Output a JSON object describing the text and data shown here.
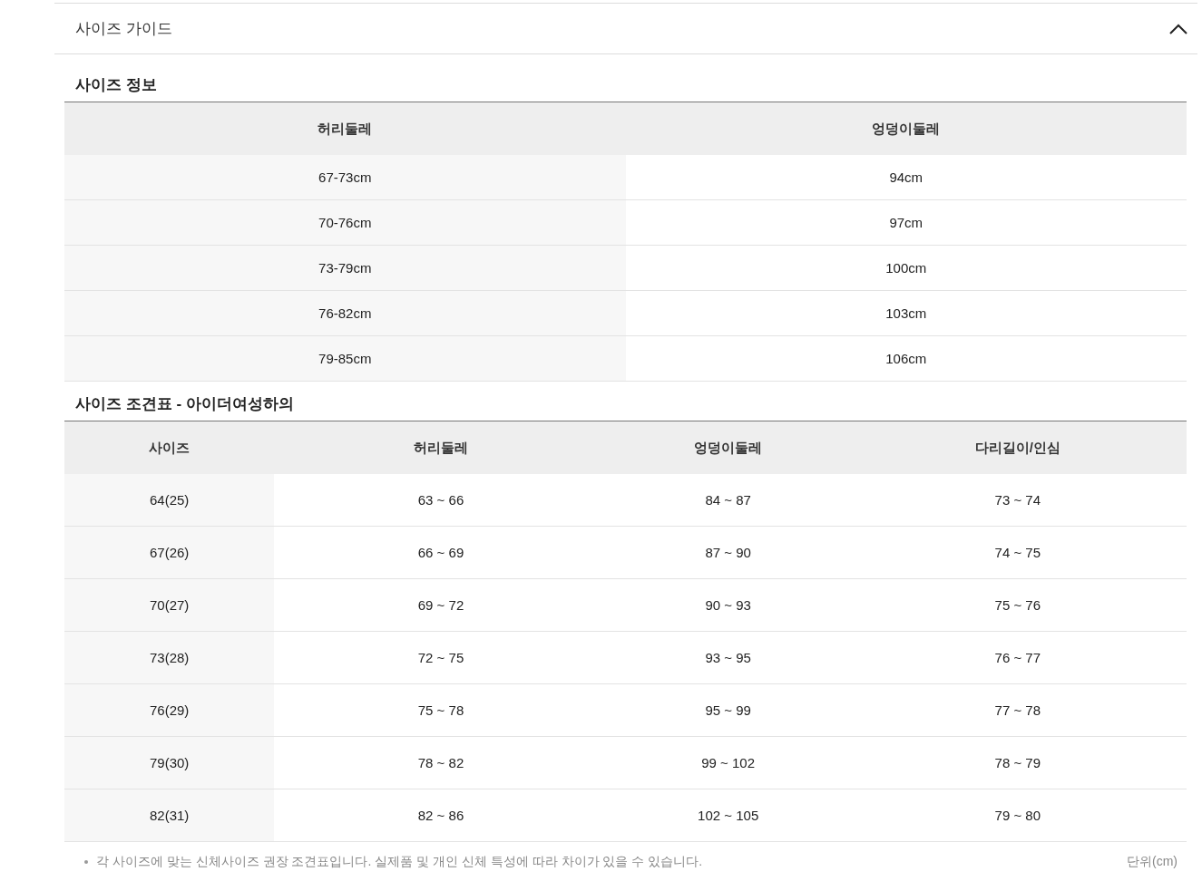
{
  "accordion": {
    "title": "사이즈 가이드",
    "expanded": true
  },
  "size_info": {
    "title": "사이즈 정보",
    "columns": [
      "허리둘레",
      "엉덩이둘레"
    ],
    "rows": [
      [
        "67-73cm",
        "94cm"
      ],
      [
        "70-76cm",
        "97cm"
      ],
      [
        "73-79cm",
        "100cm"
      ],
      [
        "76-82cm",
        "103cm"
      ],
      [
        "79-85cm",
        "106cm"
      ]
    ]
  },
  "size_chart": {
    "title": "사이즈 조견표 - 아이더여성하의",
    "columns": [
      "사이즈",
      "허리둘레",
      "엉덩이둘레",
      "다리길이/인심"
    ],
    "rows": [
      [
        "64(25)",
        "63 ~ 66",
        "84 ~ 87",
        "73 ~ 74"
      ],
      [
        "67(26)",
        "66 ~ 69",
        "87 ~ 90",
        "74 ~ 75"
      ],
      [
        "70(27)",
        "69 ~ 72",
        "90 ~ 93",
        "75 ~ 76"
      ],
      [
        "73(28)",
        "72 ~ 75",
        "93 ~ 95",
        "76 ~ 77"
      ],
      [
        "76(29)",
        "75 ~ 78",
        "95 ~ 99",
        "77 ~ 78"
      ],
      [
        "79(30)",
        "78 ~ 82",
        "99 ~ 102",
        "78 ~ 79"
      ],
      [
        "82(31)",
        "82 ~ 86",
        "102 ~ 105",
        "79 ~ 80"
      ]
    ]
  },
  "footnote": {
    "text": "각 사이즈에 맞는 신체사이즈 권장 조견표입니다. 실제품 및 개인 신체 특성에 따라 차이가 있을 수 있습니다.",
    "unit": "단위(cm)"
  }
}
